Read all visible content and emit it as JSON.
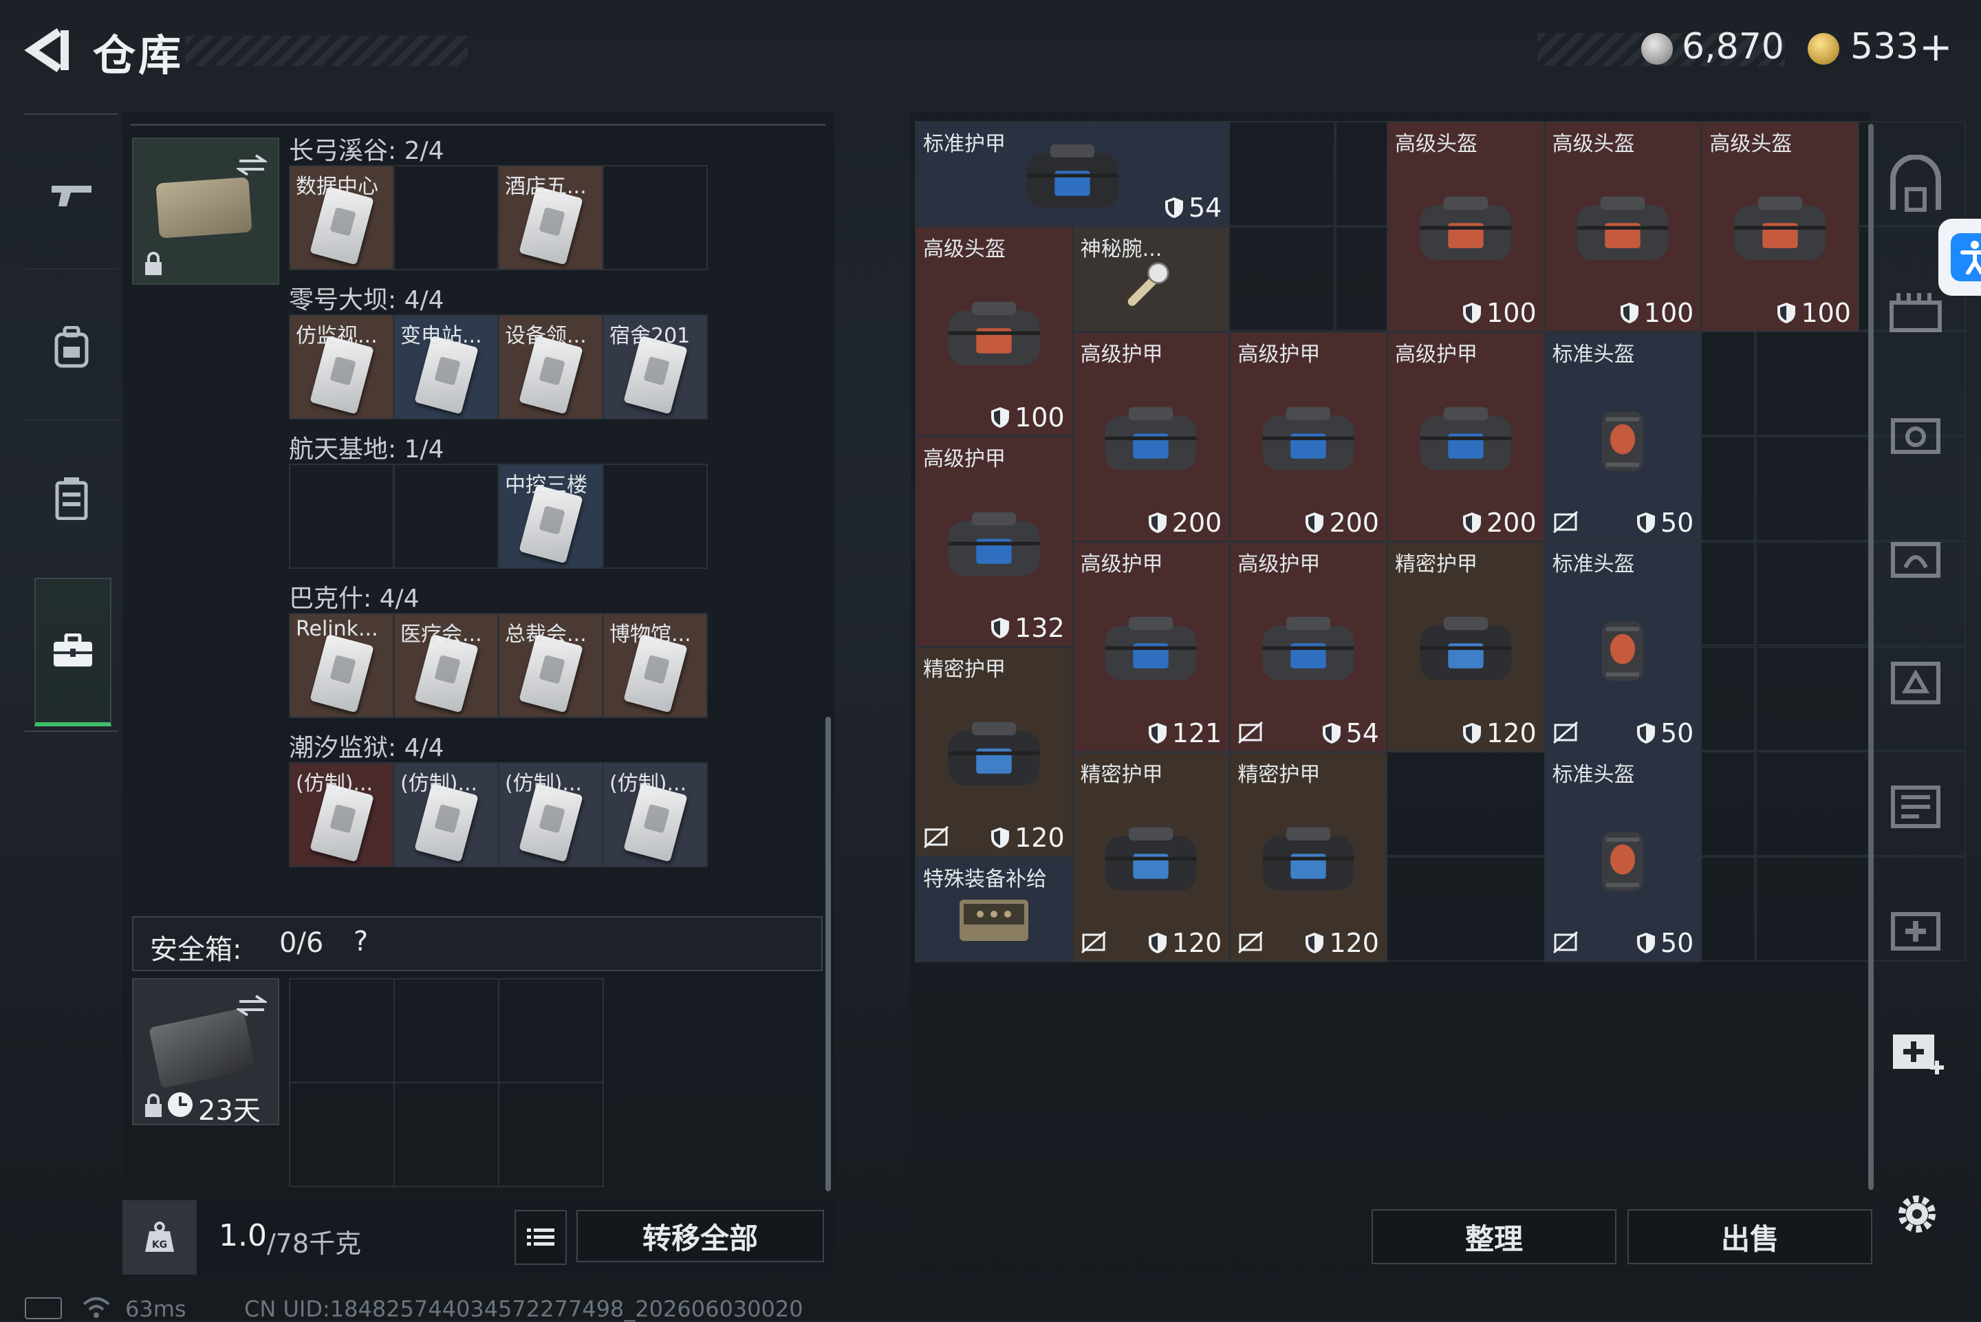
{
  "header": {
    "title": "仓库",
    "currency_silver": "6,870",
    "currency_gold": "533",
    "currency_gold_plus": "+"
  },
  "key_groups": [
    {
      "label": "长弓溪谷: 2/4",
      "slots": [
        {
          "name": "数据中心",
          "tint": "#4b3a33"
        },
        {
          "name": "",
          "tint": ""
        },
        {
          "name": "酒店五...",
          "tint": "#4b3a33"
        },
        {
          "name": "",
          "tint": ""
        }
      ]
    },
    {
      "label": "零号大坝: 4/4",
      "slots": [
        {
          "name": "仿监视...",
          "tint": "#4b3a33"
        },
        {
          "name": "变电站...",
          "tint": "#2e3b4e"
        },
        {
          "name": "设备领...",
          "tint": "#4b3a33"
        },
        {
          "name": "宿舍201",
          "tint": "#333946"
        }
      ]
    },
    {
      "label": "航天基地: 1/4",
      "slots": [
        {
          "name": "",
          "tint": ""
        },
        {
          "name": "",
          "tint": ""
        },
        {
          "name": "中控三楼",
          "tint": "#2e3b4e"
        },
        {
          "name": "",
          "tint": ""
        }
      ]
    },
    {
      "label": "巴克什: 4/4",
      "slots": [
        {
          "name": "Relink...",
          "tint": "#4b3a33"
        },
        {
          "name": "医疗会...",
          "tint": "#4b3a33"
        },
        {
          "name": "总裁会...",
          "tint": "#4b3a33"
        },
        {
          "name": "博物馆...",
          "tint": "#4b3a33"
        }
      ]
    },
    {
      "label": "潮汐监狱: 4/4",
      "slots": [
        {
          "name": "(仿制)...",
          "tint": "#4a2a2a"
        },
        {
          "name": "(仿制)...",
          "tint": "#333946"
        },
        {
          "name": "(仿制)...",
          "tint": "#333946"
        },
        {
          "name": "(仿制)...",
          "tint": "#333946"
        }
      ]
    }
  ],
  "safebox": {
    "label": "安全箱:",
    "count": "0/6",
    "help": "?",
    "timer": "23天"
  },
  "weight": {
    "value": "1.0",
    "max": "/78千克",
    "kg_icon": "KG"
  },
  "transfer_all": "转移全部",
  "sort_button": "整理",
  "sell_button": "出售",
  "status": {
    "ping": "63ms",
    "uid": "CN UID:184825744034572277498_202606030020"
  },
  "stash_items": [
    {
      "title": "标准护甲",
      "dur": "54",
      "kind": "armor-std",
      "col": 0,
      "row": 0,
      "w": 2,
      "h": 1,
      "bg": "#2a3140",
      "noins": false
    },
    {
      "title": "高级头盔",
      "dur": "100",
      "kind": "helmet-adv",
      "col": 3,
      "row": 0,
      "w": 1,
      "h": 2,
      "bg": "#4a2c2c",
      "noins": false
    },
    {
      "title": "高级头盔",
      "dur": "100",
      "kind": "helmet-adv",
      "col": 4,
      "row": 0,
      "w": 1,
      "h": 2,
      "bg": "#4a2c2c",
      "noins": false
    },
    {
      "title": "高级头盔",
      "dur": "100",
      "kind": "helmet-adv",
      "col": 5,
      "row": 0,
      "w": 1,
      "h": 2,
      "bg": "#4a2c2c",
      "noins": false
    },
    {
      "title": "高级头盔",
      "dur": "100",
      "kind": "helmet-adv",
      "col": 0,
      "row": 1,
      "w": 1,
      "h": 2,
      "bg": "#4a2c2c",
      "noins": false
    },
    {
      "title": "神秘腕...",
      "dur": "",
      "kind": "watch",
      "col": 1,
      "row": 1,
      "w": 1,
      "h": 1,
      "bg": "#3a3530",
      "noins": false
    },
    {
      "title": "高级护甲",
      "dur": "200",
      "kind": "armor-adv",
      "col": 1,
      "row": 2,
      "w": 1,
      "h": 2,
      "bg": "#4a2c2c",
      "noins": false
    },
    {
      "title": "高级护甲",
      "dur": "200",
      "kind": "armor-adv",
      "col": 2,
      "row": 2,
      "w": 1,
      "h": 2,
      "bg": "#4a2c2c",
      "noins": false
    },
    {
      "title": "高级护甲",
      "dur": "200",
      "kind": "armor-adv",
      "col": 3,
      "row": 2,
      "w": 1,
      "h": 2,
      "bg": "#4a2c2c",
      "noins": false
    },
    {
      "title": "标准头盔",
      "dur": "50",
      "kind": "helmet-std",
      "col": 4,
      "row": 2,
      "w": 1,
      "h": 2,
      "bg": "#2a3140",
      "noins": true
    },
    {
      "title": "高级护甲",
      "dur": "132",
      "kind": "armor-adv",
      "col": 0,
      "row": 3,
      "w": 1,
      "h": 2,
      "bg": "#4a2c2c",
      "noins": false
    },
    {
      "title": "高级护甲",
      "dur": "121",
      "kind": "armor-adv",
      "col": 1,
      "row": 4,
      "w": 1,
      "h": 2,
      "bg": "#4a2c2c",
      "noins": false
    },
    {
      "title": "高级护甲",
      "dur": "54",
      "kind": "armor-adv",
      "col": 2,
      "row": 4,
      "w": 1,
      "h": 2,
      "bg": "#4a2c2c",
      "noins": true
    },
    {
      "title": "精密护甲",
      "dur": "120",
      "kind": "armor-prec",
      "col": 3,
      "row": 4,
      "w": 1,
      "h": 2,
      "bg": "#3e332a",
      "noins": false
    },
    {
      "title": "标准头盔",
      "dur": "50",
      "kind": "helmet-std",
      "col": 4,
      "row": 4,
      "w": 1,
      "h": 2,
      "bg": "#2a3140",
      "noins": true
    },
    {
      "title": "精密护甲",
      "dur": "120",
      "kind": "armor-prec",
      "col": 0,
      "row": 5,
      "w": 1,
      "h": 2,
      "bg": "#3e332a",
      "noins": true
    },
    {
      "title": "精密护甲",
      "dur": "120",
      "kind": "armor-prec",
      "col": 1,
      "row": 6,
      "w": 1,
      "h": 2,
      "bg": "#3e332a",
      "noins": true
    },
    {
      "title": "精密护甲",
      "dur": "120",
      "kind": "armor-prec",
      "col": 2,
      "row": 6,
      "w": 1,
      "h": 2,
      "bg": "#3e332a",
      "noins": true
    },
    {
      "title": "标准头盔",
      "dur": "50",
      "kind": "helmet-std",
      "col": 4,
      "row": 6,
      "w": 1,
      "h": 2,
      "bg": "#2a3140",
      "noins": true
    },
    {
      "title": "特殊装备补给",
      "dur": "",
      "kind": "supply",
      "col": 0,
      "row": 7,
      "w": 1,
      "h": 1,
      "bg": "#2a3140",
      "noins": false
    }
  ],
  "colors": {
    "accent_green": "#3fbf6a",
    "accent_blue": "#1e88ff"
  }
}
